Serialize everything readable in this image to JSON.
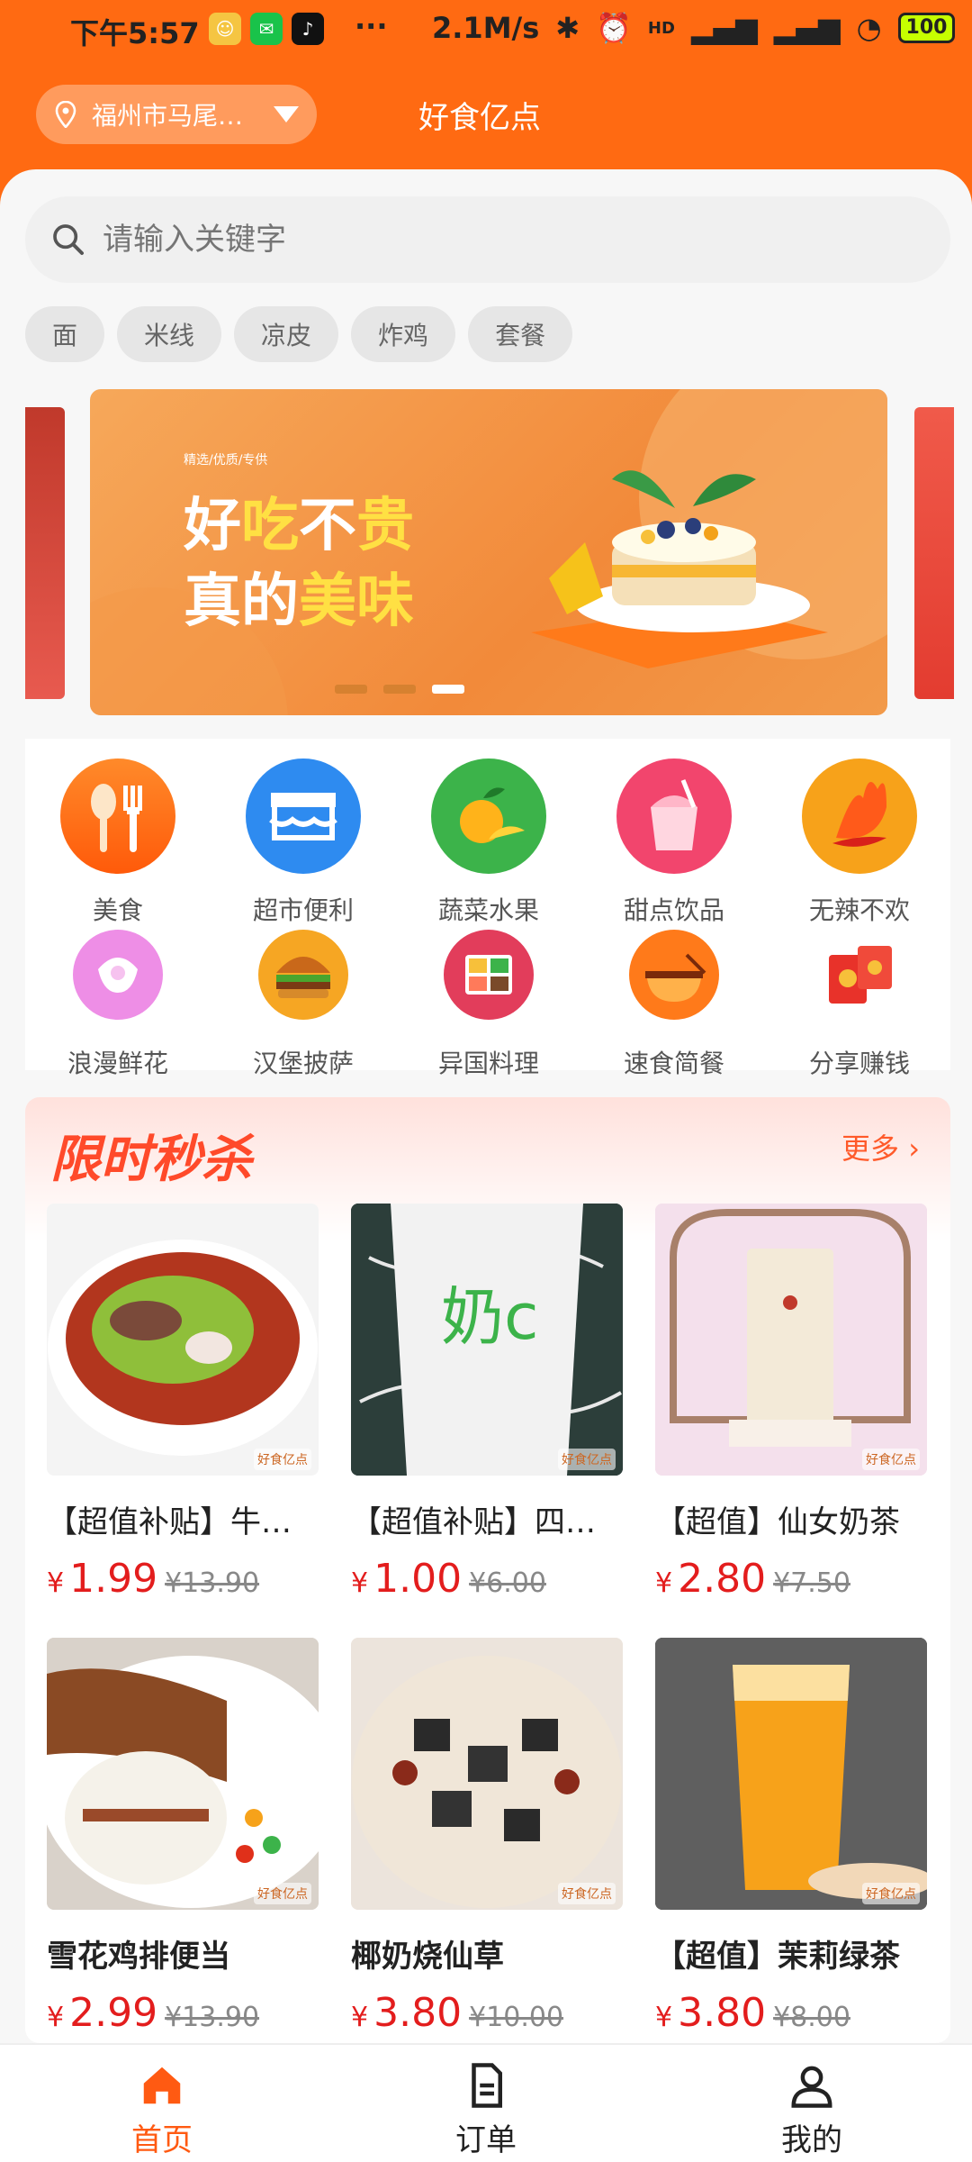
{
  "status_bar": {
    "time": "下午5:57",
    "dots": "···",
    "net_speed": "2.1M/s",
    "signal1": "HD",
    "battery": "100"
  },
  "header": {
    "location": "福州市马尾…",
    "title": "好食亿点"
  },
  "search": {
    "placeholder": "请输入关键字"
  },
  "chips": [
    "面",
    "米线",
    "凉皮",
    "炸鸡",
    "套餐"
  ],
  "banner": {
    "tagline": "精选/优质/专供",
    "line1_a": "好",
    "line1_b": "吃",
    "line1_c": "不",
    "line1_d": "贵",
    "line2_a": "真的",
    "line2_b": "美味",
    "active_dot": 3
  },
  "categories": [
    {
      "label": "美食",
      "icon": "utensils-icon",
      "color": "#ff6a1a"
    },
    {
      "label": "超市便利",
      "icon": "store-icon",
      "color": "#2e8bf0"
    },
    {
      "label": "蔬菜水果",
      "icon": "orange-icon",
      "color": "#3cb34a"
    },
    {
      "label": "甜点饮品",
      "icon": "drink-icon",
      "color": "#f2456d"
    },
    {
      "label": "无辣不欢",
      "icon": "chili-icon",
      "color": "#f7a21a"
    },
    {
      "label": "浪漫鲜花",
      "icon": "flower-icon",
      "color": "#ee8ee6"
    },
    {
      "label": "汉堡披萨",
      "icon": "burger-icon",
      "color": "#f6a623"
    },
    {
      "label": "异国料理",
      "icon": "bento-icon",
      "color": "#e23d5b"
    },
    {
      "label": "速食简餐",
      "icon": "bowl-icon",
      "color": "#ff7a1a"
    },
    {
      "label": "分享赚钱",
      "icon": "redpacket-icon",
      "color": "#e8322a"
    }
  ],
  "flash_sale": {
    "title": "限时秒杀",
    "more": "更多",
    "watermark": "好食亿点",
    "products": [
      {
        "name": "【超值补贴】牛…",
        "price": "1.99",
        "original": "¥13.90"
      },
      {
        "name": "【超值补贴】四…",
        "price": "1.00",
        "original": "¥6.00"
      },
      {
        "name": "【超值】仙女奶茶",
        "price": "2.80",
        "original": "¥7.50"
      },
      {
        "name": "雪花鸡排便当",
        "price": "2.99",
        "original": "¥13.90"
      },
      {
        "name": "椰奶烧仙草",
        "price": "3.80",
        "original": "¥10.00"
      },
      {
        "name": "【超值】茉莉绿茶",
        "price": "3.80",
        "original": "¥8.00"
      }
    ],
    "currency": "¥"
  },
  "tabbar": {
    "home": "首页",
    "orders": "订单",
    "mine": "我的"
  },
  "colors": {
    "brand": "#ff6a12",
    "price": "#e31d1d"
  }
}
